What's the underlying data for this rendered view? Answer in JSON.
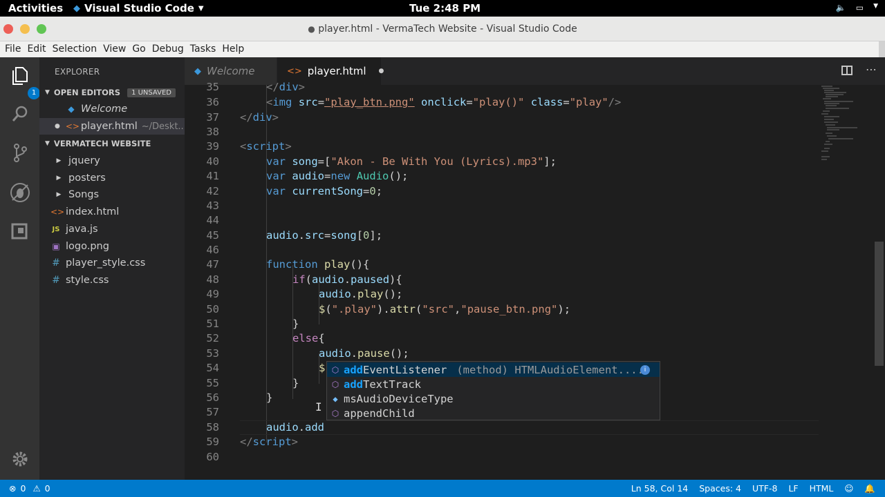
{
  "topbar": {
    "activities": "Activities",
    "app_name": "Visual Studio Code",
    "clock": "Tue  2:48 PM"
  },
  "window": {
    "title": "player.html - VermaTech Website - Visual Studio Code"
  },
  "menu": [
    "File",
    "Edit",
    "Selection",
    "View",
    "Go",
    "Debug",
    "Tasks",
    "Help"
  ],
  "activitybar": {
    "explorer_badge": "1"
  },
  "sidebar": {
    "header": "EXPLORER",
    "open_editors": {
      "label": "OPEN EDITORS",
      "unsaved": "1 UNSAVED",
      "items": [
        {
          "name": "Welcome"
        },
        {
          "name": "player.html",
          "path": "~/Deskt..."
        }
      ]
    },
    "project": {
      "label": "VERMATECH WEBSITE",
      "items": [
        {
          "name": "jquery",
          "type": "folder"
        },
        {
          "name": "posters",
          "type": "folder"
        },
        {
          "name": "Songs",
          "type": "folder"
        },
        {
          "name": "index.html",
          "type": "html"
        },
        {
          "name": "java.js",
          "type": "js"
        },
        {
          "name": "logo.png",
          "type": "image"
        },
        {
          "name": "player_style.css",
          "type": "css"
        },
        {
          "name": "style.css",
          "type": "css"
        }
      ]
    }
  },
  "tabs": [
    {
      "label": "Welcome",
      "active": false
    },
    {
      "label": "player.html",
      "active": true,
      "dirty": true
    }
  ],
  "editor": {
    "line_numbers": [
      "35",
      "36",
      "37",
      "38",
      "39",
      "40",
      "41",
      "42",
      "43",
      "44",
      "45",
      "46",
      "47",
      "48",
      "49",
      "50",
      "51",
      "52",
      "53",
      "54",
      "55",
      "56",
      "57",
      "58",
      "59",
      "60"
    ]
  },
  "suggest": {
    "items": [
      {
        "prefix": "add",
        "rest": "EventListener",
        "detail": "(method) HTMLAudioElement....",
        "kind": "method"
      },
      {
        "prefix": "add",
        "rest": "TextTrack",
        "detail": "",
        "kind": "method"
      },
      {
        "prefix": "",
        "rest": "msAudioDeviceType",
        "detail": "",
        "kind": "property"
      },
      {
        "prefix": "",
        "rest": "appendChild",
        "detail": "",
        "kind": "method"
      }
    ]
  },
  "statusbar": {
    "errors": "0",
    "warnings": "0",
    "position": "Ln 58, Col 14",
    "spaces": "Spaces: 4",
    "encoding": "UTF-8",
    "eol": "LF",
    "language": "HTML"
  },
  "colors": {
    "statusbar": "#007acc",
    "editor_bg": "#1e1e1e",
    "sidebar_bg": "#252526"
  }
}
